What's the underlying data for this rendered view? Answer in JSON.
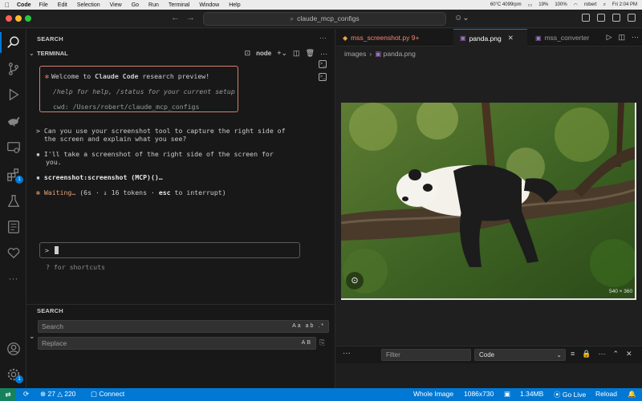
{
  "menubar": {
    "app": "Code",
    "items": [
      "File",
      "Edit",
      "Selection",
      "View",
      "Go",
      "Run",
      "Terminal",
      "Window",
      "Help"
    ],
    "status": [
      "60°C 4099rpm",
      "19%",
      "100%",
      "robert",
      "Fri 2:04 PM"
    ]
  },
  "titlebar": {
    "search_text": "claude_mcp_configs"
  },
  "sidebar": {
    "top_section_title": "SEARCH",
    "terminal_title": "TERMINAL",
    "terminal_shell": "node",
    "bottom_section_title": "SEARCH",
    "search_placeholder": "Search",
    "search_options": "Aa ab .*",
    "replace_placeholder": "Replace",
    "replace_options": "AB"
  },
  "terminal": {
    "welcome_pre": "Welcome to ",
    "welcome_bold": "Claude Code",
    "welcome_post": " research preview!",
    "help_line": "/help for help, /status for your current setup",
    "cwd_line": "cwd: /Users/robert/claude_mcp_configs",
    "user_msg_1": "> Can you use your screenshot tool to capture the right side of",
    "user_msg_2": "  the screen and explain what you see?",
    "reply_1": "I'll take a screenshot of the right side of the screen for",
    "reply_2": "you.",
    "tool_call": "screenshot:screenshot (MCP)()…",
    "waiting_word": "Waiting…",
    "waiting_detail": " (6s · ↓ 16 tokens · ",
    "waiting_key": "esc",
    "waiting_tail": " to interrupt)",
    "prompt_symbol": ">",
    "shortcuts_hint": "? for shortcuts"
  },
  "editor": {
    "tabs": [
      {
        "label": "mss_screenshot.py 9+",
        "color": "#f48771"
      },
      {
        "label": "panda.png",
        "color": "#ffffff"
      },
      {
        "label": "mss_converter",
        "color": "#9d9d9d"
      }
    ],
    "breadcrumb": [
      "images",
      "panda.png"
    ],
    "image_dims_label": "540 × 360"
  },
  "panel": {
    "filter_placeholder": "Filter",
    "select_value": "Code"
  },
  "statusbar": {
    "errors": "27",
    "warnings": "220",
    "connect": "Connect",
    "whole_image": "Whole Image",
    "resolution": "1086x730",
    "size": "1.34MB",
    "go_live": "Go Live",
    "reload": "Reload"
  },
  "colors": {
    "accent": "#0078d4",
    "welcome_border": "#d77f70",
    "waiting": "#e6a57a"
  }
}
